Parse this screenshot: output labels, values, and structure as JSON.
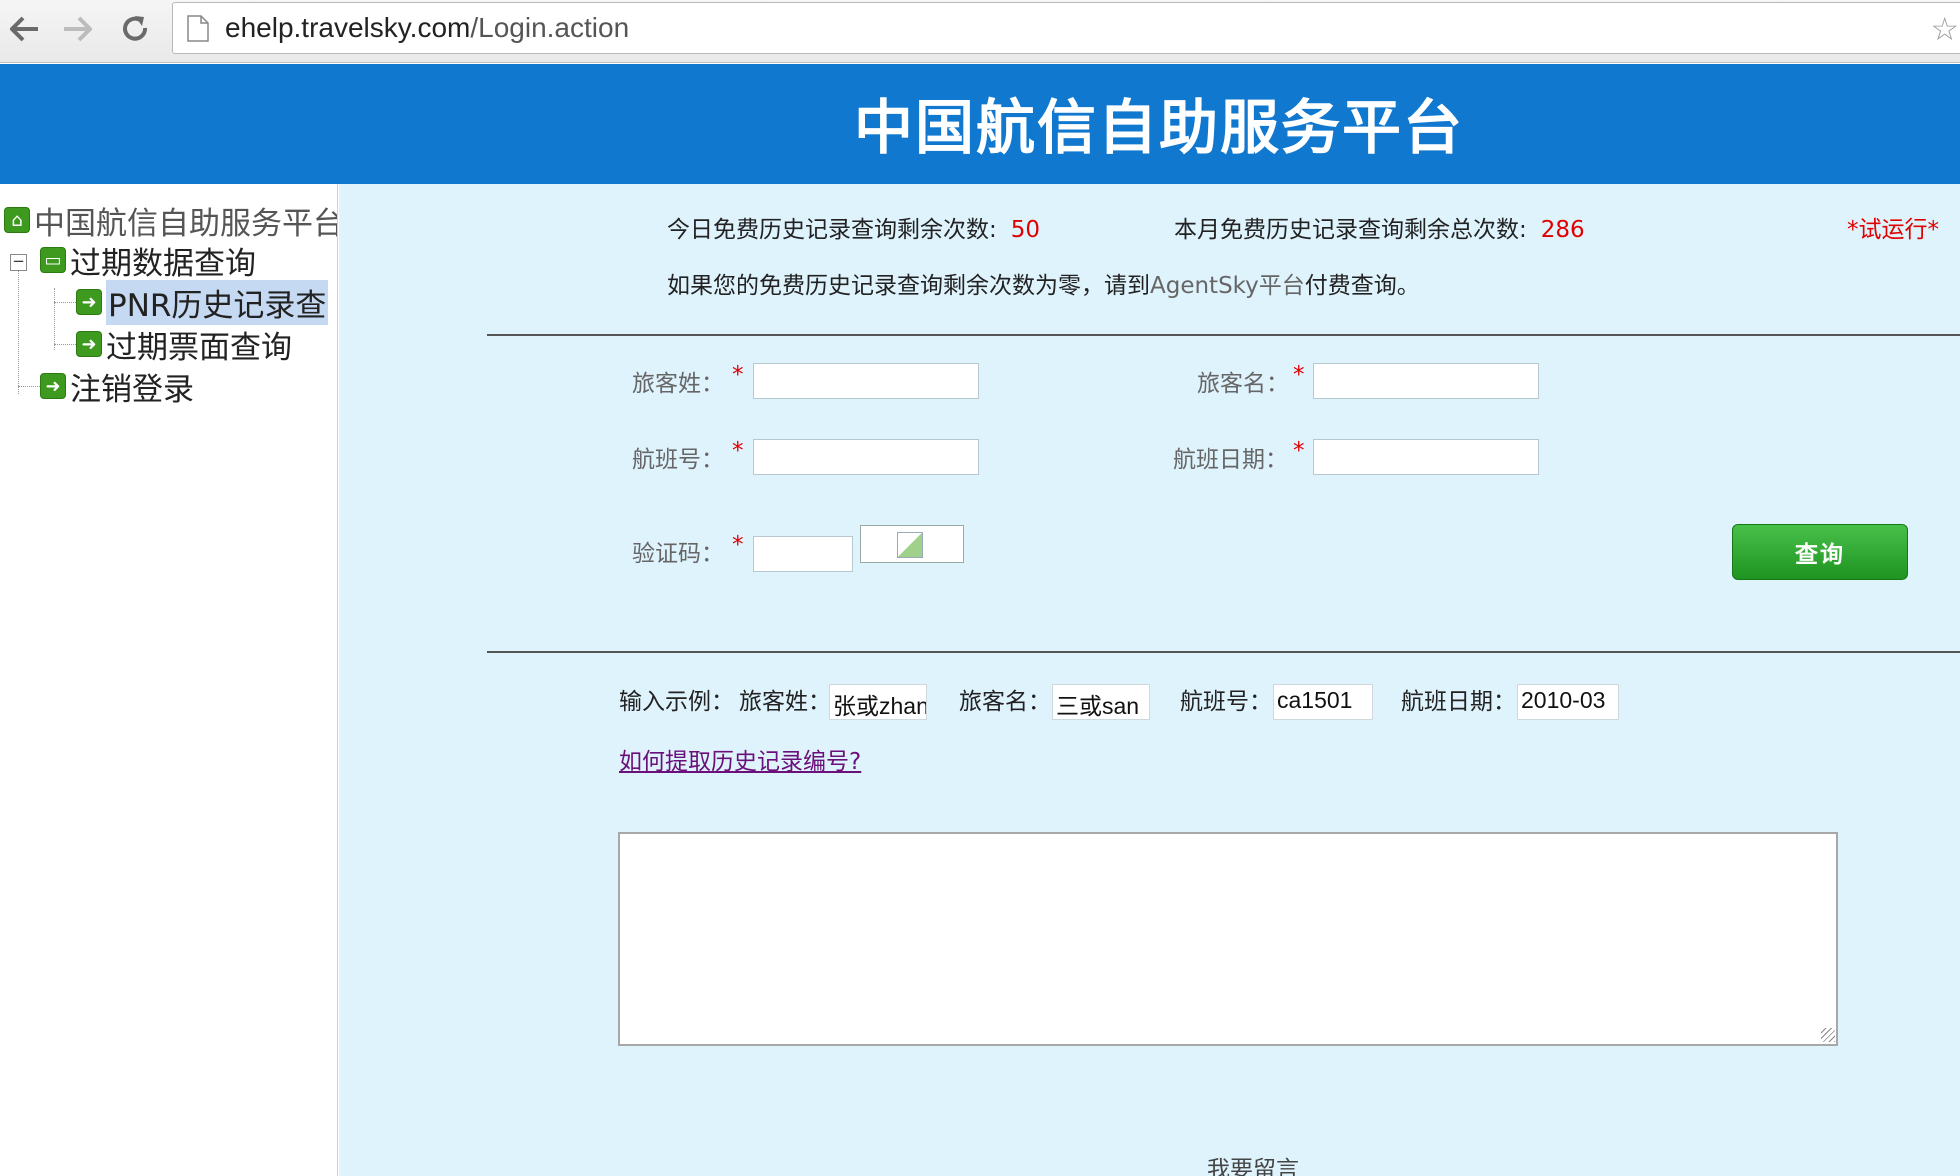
{
  "browser": {
    "url_host": "ehelp.travelsky.com",
    "url_path": "/Login.action",
    "star_icon": "☆"
  },
  "header": {
    "title": "中国航信自助服务平台"
  },
  "sidebar": {
    "root": "中国航信自助服务平台",
    "folder": "过期数据查询",
    "items": [
      {
        "label": "PNR历史记录查"
      },
      {
        "label": "过期票面查询"
      }
    ],
    "logout": "注销登录",
    "expander": "−"
  },
  "info": {
    "today_label": "今日免费历史记录查询剩余次数:",
    "today_value": "50",
    "month_label": "本月免费历史记录查询剩余总次数:",
    "month_value": "286",
    "trial": "*试运行*",
    "notice_prefix": "如果您的免费历史记录查询剩余次数为零，请到",
    "notice_platform": "AgentSky平台",
    "notice_suffix": "付费查询。"
  },
  "form": {
    "surname_label": "旅客姓：",
    "givenname_label": "旅客名：",
    "flight_label": "航班号：",
    "date_label": "航班日期：",
    "captcha_label": "验证码：",
    "required_mark": "*",
    "surname_value": "",
    "givenname_value": "",
    "flight_value": "",
    "date_value": "",
    "captcha_value": "",
    "query_button": "查询"
  },
  "example": {
    "prefix": "输入示例：",
    "surname_label": "旅客姓：",
    "surname_value": "张或zhang",
    "givenname_label": "旅客名：",
    "givenname_value": "三或san",
    "flight_label": "航班号：",
    "flight_value": "ca1501",
    "date_label": "航班日期：",
    "date_value": "2010-03"
  },
  "help_link": "如何提取历史记录编号?",
  "leave_message": "我要留言",
  "colors": {
    "header_bg": "#1078cf",
    "content_bg": "#dff3fd",
    "required": "#e10000",
    "button": "#2aa82c",
    "link": "#6b0f7a"
  }
}
